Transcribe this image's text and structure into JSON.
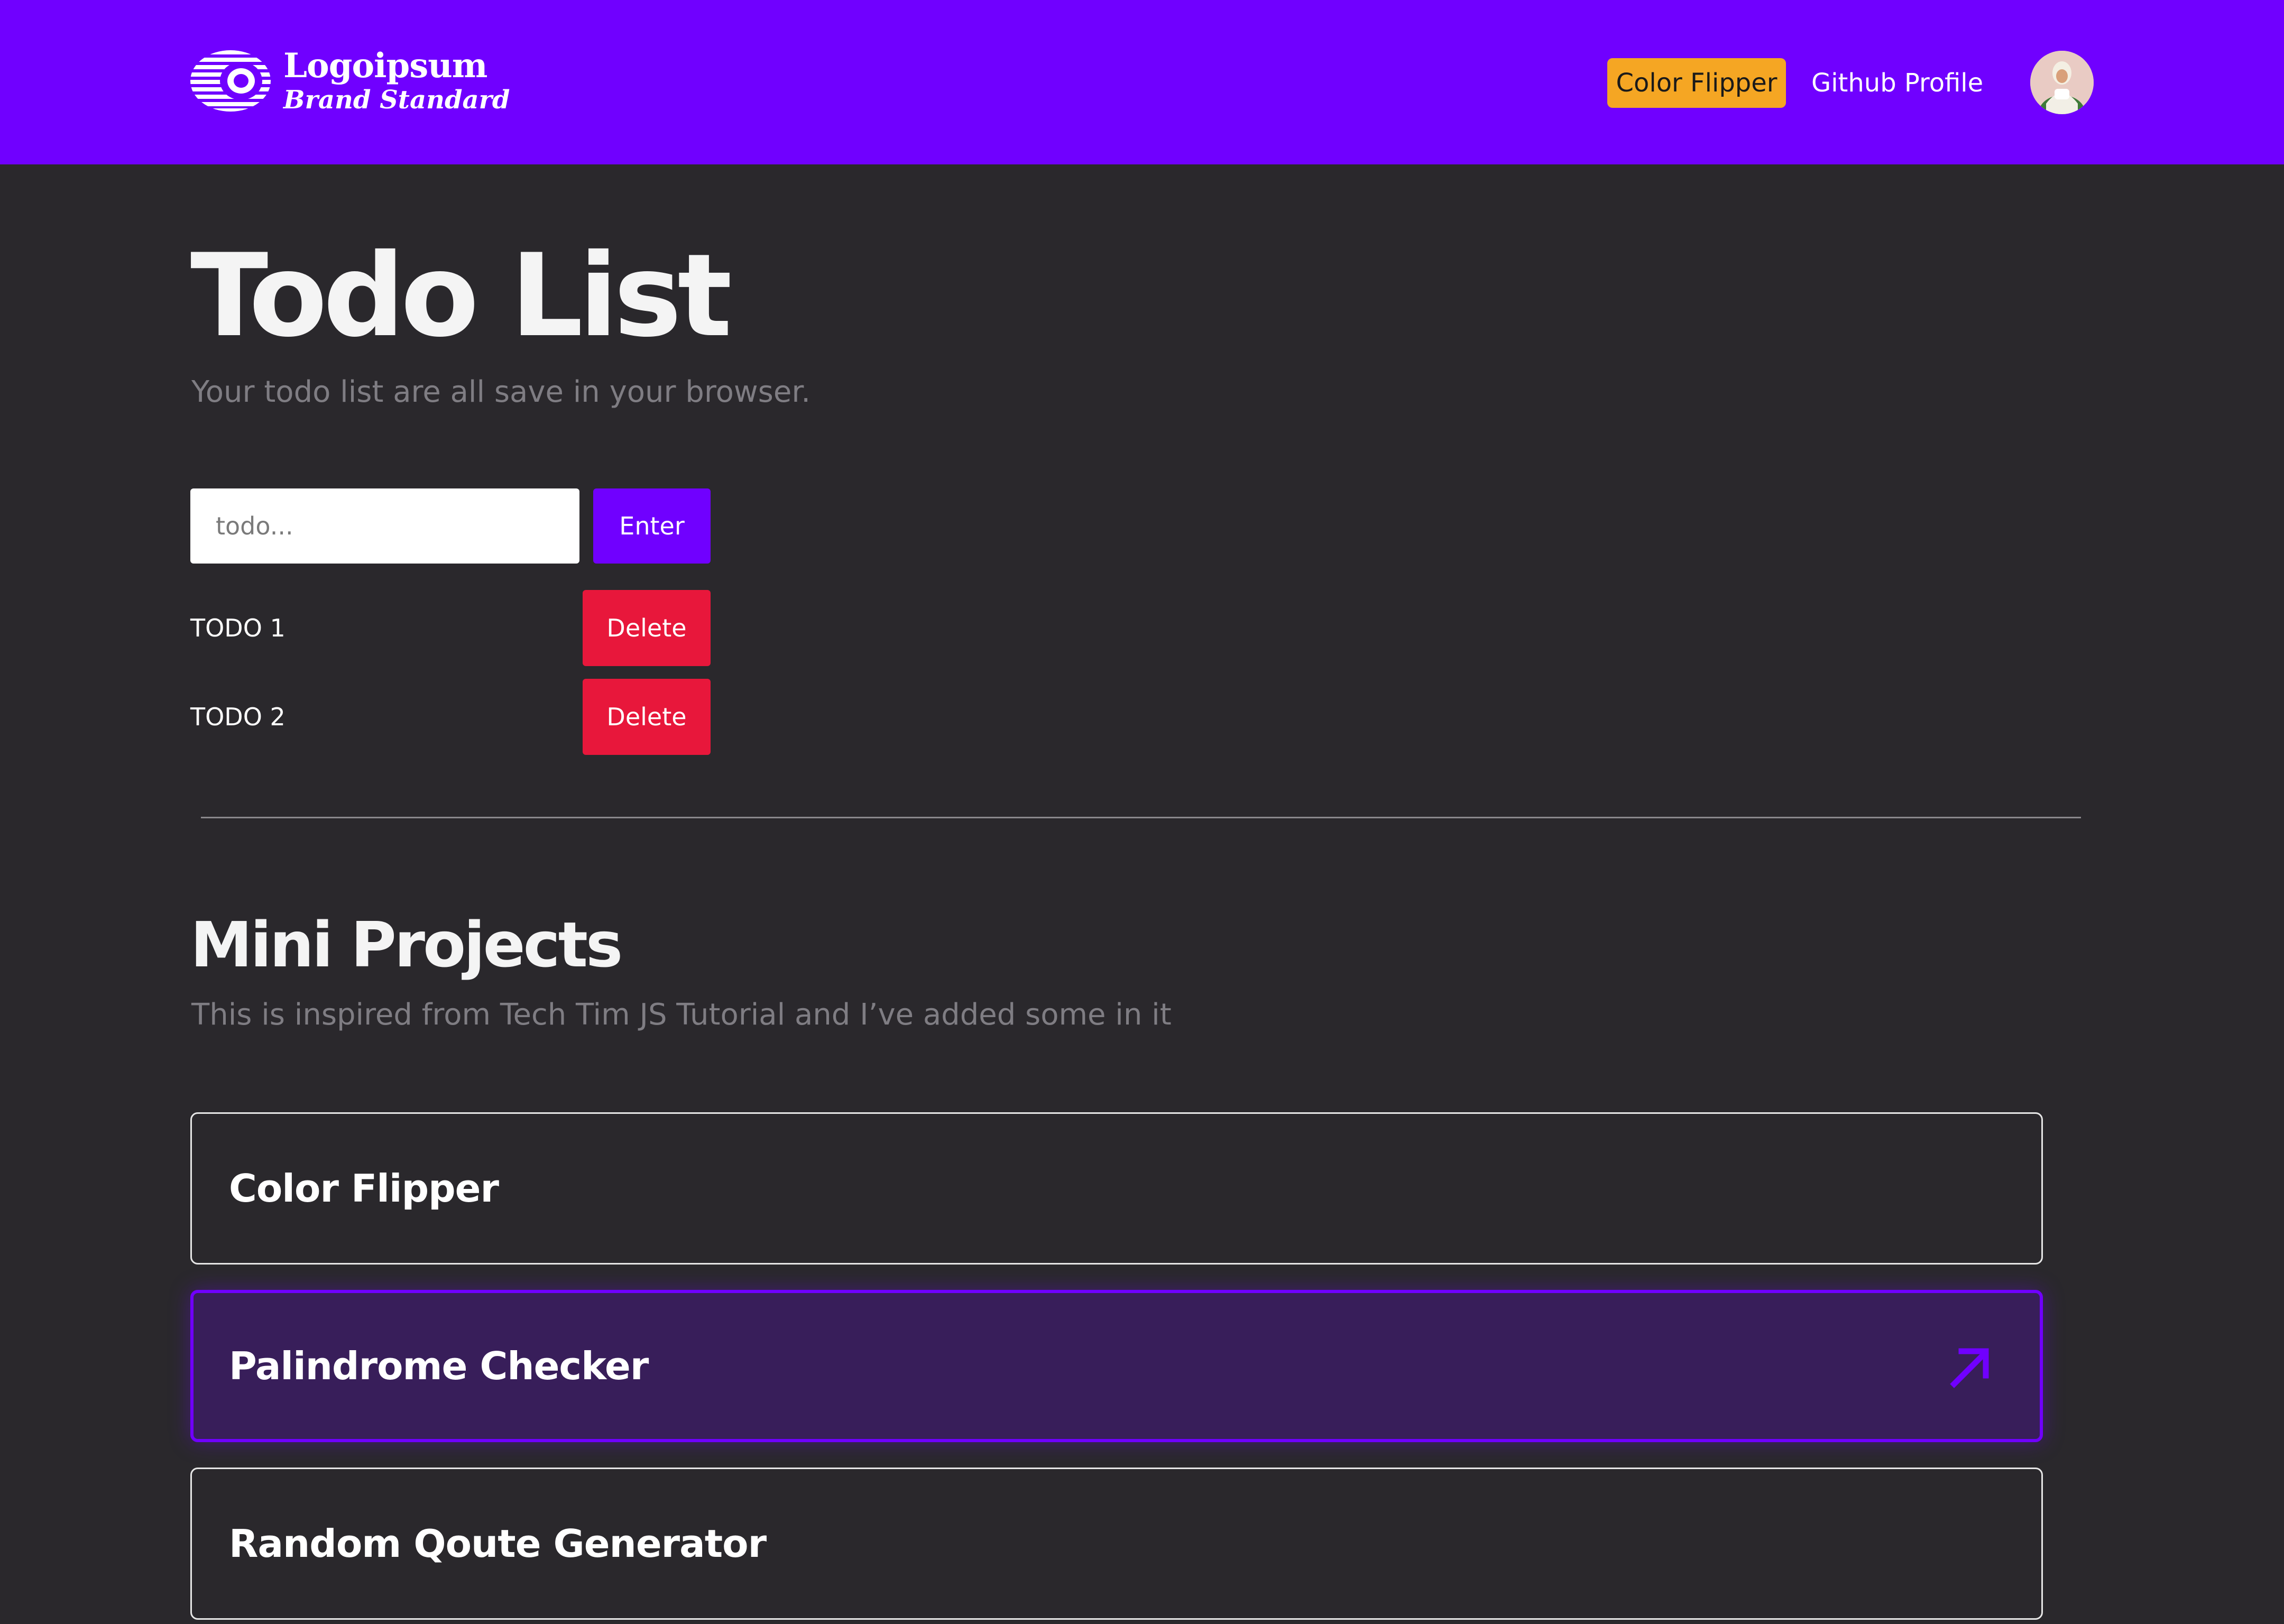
{
  "header": {
    "logo_name": "Logoipsum",
    "logo_sub": "Brand Standard",
    "nav_pill_label": "Color Flipper",
    "nav_link_label": "Github Profile",
    "avatar": "avatar-icon"
  },
  "todo": {
    "title": "Todo List",
    "subtitle": "Your todo list are all save in your browser.",
    "input_placeholder": "todo...",
    "input_value": "",
    "enter_label": "Enter",
    "items": [
      {
        "text": "TODO 1",
        "delete_label": "Delete"
      },
      {
        "text": "TODO 2",
        "delete_label": "Delete"
      }
    ]
  },
  "projects": {
    "title": "Mini Projects",
    "subtitle": "This is inspired from Tech Tim JS Tutorial and I’ve added some in it",
    "cards": [
      {
        "label": "Color Flipper",
        "active": false
      },
      {
        "label": "Palindrome Checker",
        "active": true,
        "icon": "arrow-up-right-icon"
      },
      {
        "label": "Random Qoute Generator",
        "active": false
      }
    ]
  },
  "colors": {
    "brand": "#7000ff",
    "background": "#2a282c",
    "accent_pill": "#f5a623",
    "danger": "#e8173b",
    "active_card_bg": "#381e5a",
    "muted_text": "#7f7d83"
  }
}
